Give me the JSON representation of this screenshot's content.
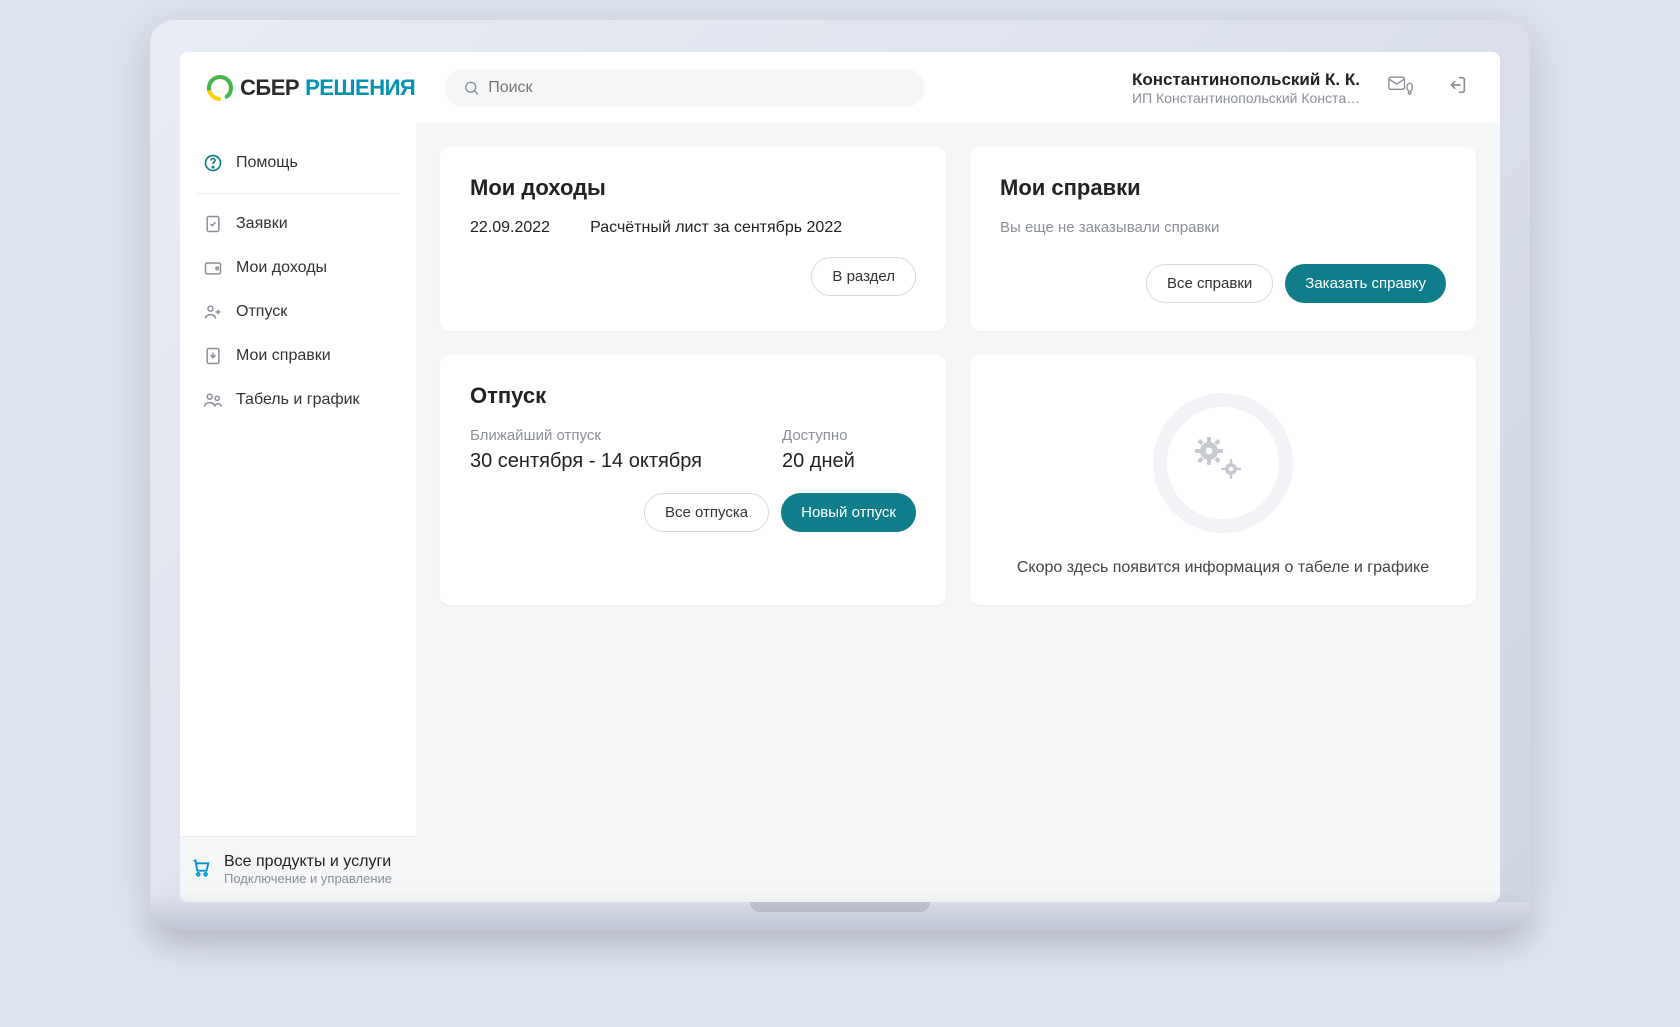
{
  "brand": {
    "part1": "СБЕР",
    "part2": "РЕШЕНИЯ"
  },
  "search": {
    "placeholder": "Поиск"
  },
  "user": {
    "name": "Константинопольский К. К.",
    "subtitle": "ИП Константинопольский Констант..."
  },
  "sidebar": {
    "help": "Помощь",
    "items": [
      {
        "label": "Заявки"
      },
      {
        "label": "Мои доходы"
      },
      {
        "label": "Отпуск"
      },
      {
        "label": "Мои справки"
      },
      {
        "label": "Табель и график"
      }
    ],
    "footer_title": "Все продукты и услуги",
    "footer_sub": "Подключение и управление"
  },
  "income": {
    "title": "Мои доходы",
    "date": "22.09.2022",
    "desc": "Расчётный лист за сентябрь 2022",
    "action": "В раздел"
  },
  "certs": {
    "title": "Мои справки",
    "empty": "Вы еще не заказывали справки",
    "action_all": "Все справки",
    "action_new": "Заказать справку"
  },
  "vacation": {
    "title": "Отпуск",
    "next_label": "Ближайший отпуск",
    "next_value": "30 сентября - 14 октября",
    "avail_label": "Доступно",
    "avail_value": "20 дней",
    "action_all": "Все отпуска",
    "action_new": "Новый отпуск"
  },
  "timesheet": {
    "placeholder": "Скоро здесь появится информация о табеле и графике"
  }
}
